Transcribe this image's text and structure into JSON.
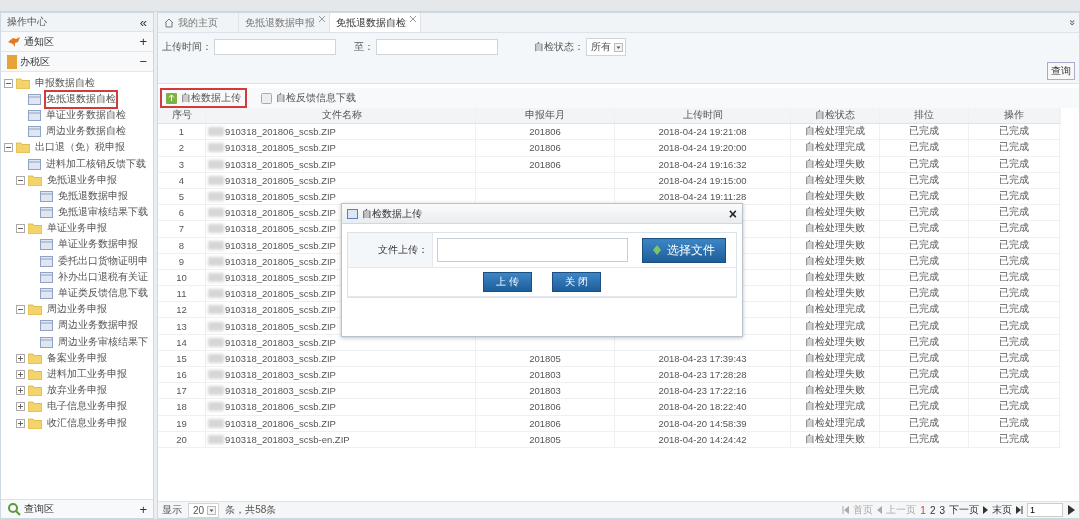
{
  "sidebar": {
    "title": "操作中心",
    "collapse_glyph": "«",
    "sections": [
      {
        "label": "通知区",
        "toggle": "+",
        "kind": "notice"
      },
      {
        "label": "办税区",
        "toggle": "−",
        "kind": "office"
      }
    ],
    "tree": [
      {
        "label": "申报数据自检",
        "kind": "folder",
        "expanded": true,
        "selected": false,
        "children": [
          {
            "label": "免抵退数据自检",
            "kind": "page",
            "selected": true
          },
          {
            "label": "单证业务数据自检",
            "kind": "page",
            "selected": false
          },
          {
            "label": "周边业务数据自检",
            "kind": "page",
            "selected": false
          }
        ]
      },
      {
        "label": "出口退（免）税申报",
        "kind": "folder",
        "expanded": true,
        "selected": false,
        "children": [
          {
            "label": "进料加工核销反馈下载",
            "kind": "page",
            "selected": false
          },
          {
            "label": "免抵退业务申报",
            "kind": "folder",
            "expanded": true,
            "selected": false,
            "children": [
              {
                "label": "免抵退数据申报",
                "kind": "page",
                "selected": false
              },
              {
                "label": "免抵退审核结果下载",
                "kind": "page",
                "selected": false
              }
            ]
          },
          {
            "label": "单证业务申报",
            "kind": "folder",
            "expanded": true,
            "selected": false,
            "children": [
              {
                "label": "单证业务数据申报",
                "kind": "page",
                "selected": false
              },
              {
                "label": "委托出口货物证明申",
                "kind": "page",
                "selected": false
              },
              {
                "label": "补办出口退税有关证",
                "kind": "page",
                "selected": false
              },
              {
                "label": "单证类反馈信息下载",
                "kind": "page",
                "selected": false
              }
            ]
          },
          {
            "label": "周边业务申报",
            "kind": "folder",
            "expanded": true,
            "selected": false,
            "children": [
              {
                "label": "周边业务数据申报",
                "kind": "page",
                "selected": false
              },
              {
                "label": "周边业务审核结果下",
                "kind": "page",
                "selected": false
              }
            ]
          },
          {
            "label": "备案业务申报",
            "kind": "folder",
            "expanded": false,
            "selected": false
          },
          {
            "label": "进料加工业务申报",
            "kind": "folder",
            "expanded": false,
            "selected": false
          },
          {
            "label": "放弃业务申报",
            "kind": "folder",
            "expanded": false,
            "selected": false
          },
          {
            "label": "电子信息业务申报",
            "kind": "folder",
            "expanded": false,
            "selected": false
          },
          {
            "label": "收汇信息业务申报",
            "kind": "folder",
            "expanded": false,
            "selected": false
          }
        ]
      }
    ],
    "footer": {
      "label": "查询区",
      "toggle": "+"
    }
  },
  "tabs": [
    {
      "label": "我的主页",
      "kind": "home",
      "selected": false
    },
    {
      "label": "免抵退数据申报",
      "kind": "closable",
      "selected": false
    },
    {
      "label": "免抵退数据自检",
      "kind": "closable",
      "selected": true
    }
  ],
  "tabs_menu_glyph": "»",
  "filters": {
    "upload_time_label": "上传时间：",
    "to_label": "至：",
    "status_label": "自检状态：",
    "status_value": "所有",
    "query_button": "查询"
  },
  "toolbar": [
    {
      "label": "自检数据上传",
      "kind": "upload",
      "highlighted": true
    },
    {
      "label": "自检反馈信息下载",
      "kind": "download",
      "highlighted": false
    }
  ],
  "table": {
    "columns": [
      "序号",
      "文件名称",
      "申报年月",
      "上传时间",
      "自检状态",
      "排位",
      "操作"
    ],
    "rows": [
      [
        "1",
        "910318_201806_scsb.ZIP",
        "201806",
        "2018-04-24 19:21:08",
        "自检处理完成",
        "已完成",
        "已完成"
      ],
      [
        "2",
        "910318_201805_scsb.ZIP",
        "201806",
        "2018-04-24 19:20:00",
        "自检处理完成",
        "已完成",
        "已完成"
      ],
      [
        "3",
        "910318_201805_scsb.ZIP",
        "201806",
        "2018-04-24 19:16:32",
        "自检处理失败",
        "已完成",
        "已完成"
      ],
      [
        "4",
        "910318_201805_scsb.ZIP",
        "",
        "2018-04-24 19:15:00",
        "自检处理失败",
        "已完成",
        "已完成"
      ],
      [
        "5",
        "910318_201805_scsb.ZIP",
        "",
        "2018-04-24 19:11:28",
        "自检处理失败",
        "已完成",
        "已完成"
      ],
      [
        "6",
        "910318_201805_scsb.ZIP",
        "",
        "",
        "自检处理失败",
        "已完成",
        "已完成"
      ],
      [
        "7",
        "910318_201805_scsb.ZIP",
        "",
        "",
        "自检处理失败",
        "已完成",
        "已完成"
      ],
      [
        "8",
        "910318_201805_scsb.ZIP",
        "",
        "",
        "自检处理失败",
        "已完成",
        "已完成"
      ],
      [
        "9",
        "910318_201805_scsb.ZIP",
        "",
        "",
        "自检处理失败",
        "已完成",
        "已完成"
      ],
      [
        "10",
        "910318_201805_scsb.ZIP",
        "",
        "",
        "自检处理失败",
        "已完成",
        "已完成"
      ],
      [
        "11",
        "910318_201805_scsb.ZIP",
        "",
        "",
        "自检处理失败",
        "已完成",
        "已完成"
      ],
      [
        "12",
        "910318_201805_scsb.ZIP",
        "",
        "",
        "自检处理完成",
        "已完成",
        "已完成"
      ],
      [
        "13",
        "910318_201805_scsb.ZIP",
        "",
        "",
        "自检处理完成",
        "已完成",
        "已完成"
      ],
      [
        "14",
        "910318_201803_scsb.ZIP",
        "",
        "",
        "自检处理失败",
        "已完成",
        "已完成"
      ],
      [
        "15",
        "910318_201803_scsb.ZIP",
        "201805",
        "2018-04-23 17:39:43",
        "自检处理完成",
        "已完成",
        "已完成"
      ],
      [
        "16",
        "910318_201803_scsb.ZIP",
        "201803",
        "2018-04-23 17:28:28",
        "自检处理失败",
        "已完成",
        "已完成"
      ],
      [
        "17",
        "910318_201803_scsb.ZIP",
        "201803",
        "2018-04-23 17:22:16",
        "自检处理失败",
        "已完成",
        "已完成"
      ],
      [
        "18",
        "910318_201806_scsb.ZIP",
        "201806",
        "2018-04-20 18:22:40",
        "自检处理完成",
        "已完成",
        "已完成"
      ],
      [
        "19",
        "910318_201806_scsb.ZIP",
        "201806",
        "2018-04-20 14:58:39",
        "自检处理完成",
        "已完成",
        "已完成"
      ],
      [
        "20",
        "910318_201803_scsb-en.ZIP",
        "201805",
        "2018-04-20 14:24:42",
        "自检处理失败",
        "已完成",
        "已完成"
      ]
    ]
  },
  "pager": {
    "show_label": "显示",
    "page_size": "20",
    "summary": "条，共58条",
    "first": "首页",
    "prev": "上一页",
    "pages": [
      {
        "label": "1",
        "selected": true
      },
      {
        "label": "2",
        "selected": false
      },
      {
        "label": "3",
        "selected": false
      }
    ],
    "next": "下一页",
    "last": "末页",
    "page_input": "1"
  },
  "dialog": {
    "title": "自检数据上传",
    "close_glyph": "×",
    "file_label": "文件上传：",
    "choose_button": "选择文件",
    "upload_button": "上 传",
    "close_button": "关 闭"
  }
}
